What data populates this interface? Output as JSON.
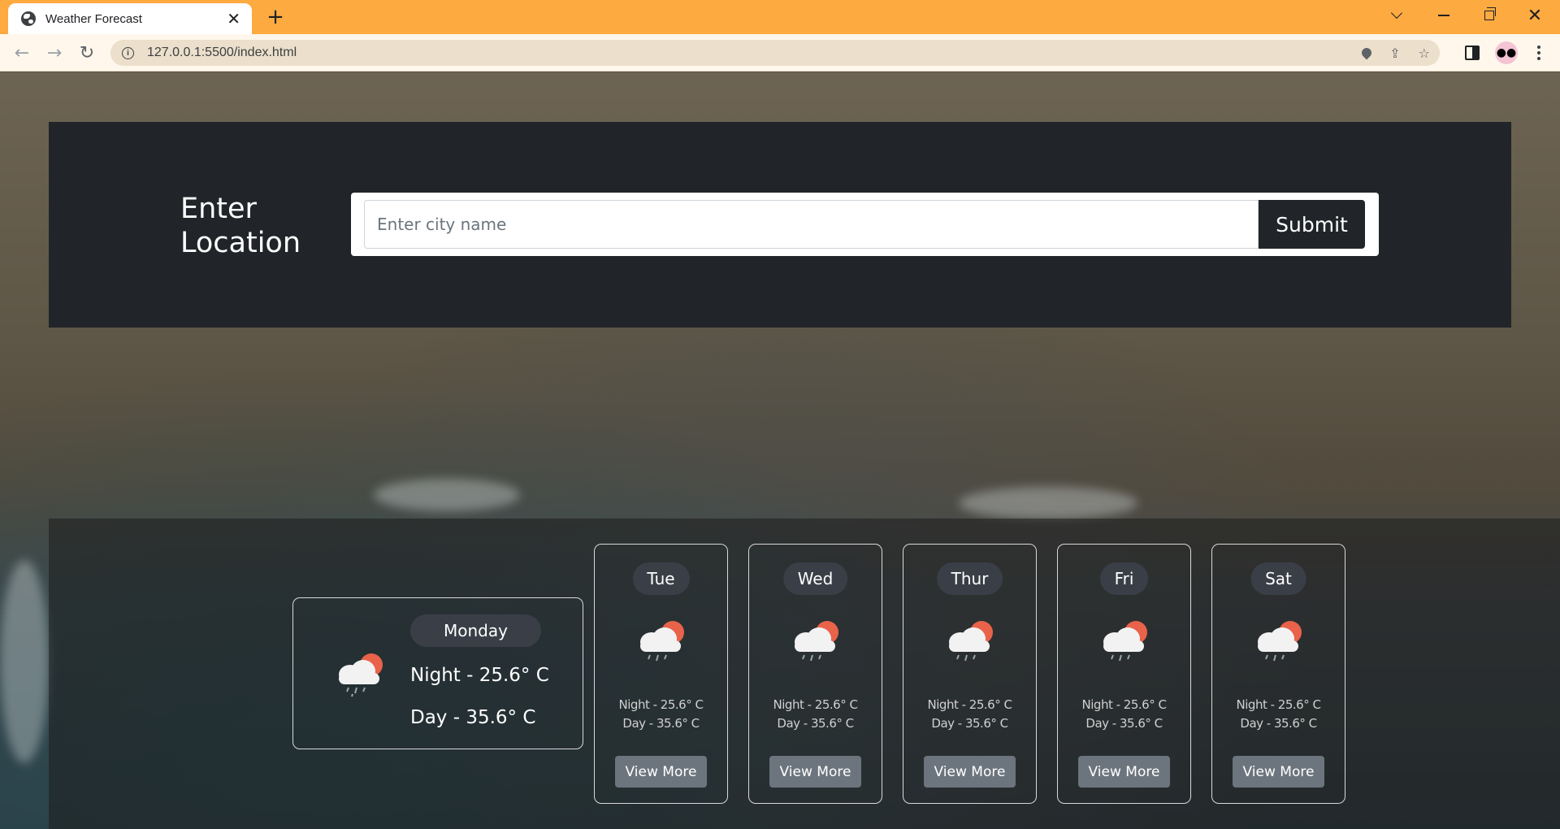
{
  "browser": {
    "tab_title": "Weather Forecast",
    "url": "127.0.0.1:5500/index.html"
  },
  "colors": {
    "tabbar": "#fdaa40",
    "panel": "#212529",
    "button_secondary": "#6c757d",
    "day_pill": "#3a3f47"
  },
  "icons": {
    "weather": "cloud-sun-rain-icon"
  },
  "search": {
    "label": "Enter Location",
    "placeholder": "Enter city name",
    "value": "",
    "submit_label": "Submit"
  },
  "today": {
    "day": "Monday",
    "night": "Night - 25.6° C",
    "day_temp": "Day - 35.6° C"
  },
  "forecast": [
    {
      "day": "Tue",
      "night": "Night - 25.6° C",
      "day_temp": "Day - 35.6° C",
      "button": "View More"
    },
    {
      "day": "Wed",
      "night": "Night - 25.6° C",
      "day_temp": "Day - 35.6° C",
      "button": "View More"
    },
    {
      "day": "Thur",
      "night": "Night - 25.6° C",
      "day_temp": "Day - 35.6° C",
      "button": "View More"
    },
    {
      "day": "Fri",
      "night": "Night - 25.6° C",
      "day_temp": "Day - 35.6° C",
      "button": "View More"
    },
    {
      "day": "Sat",
      "night": "Night - 25.6° C",
      "day_temp": "Day - 35.6° C",
      "button": "View More"
    }
  ]
}
